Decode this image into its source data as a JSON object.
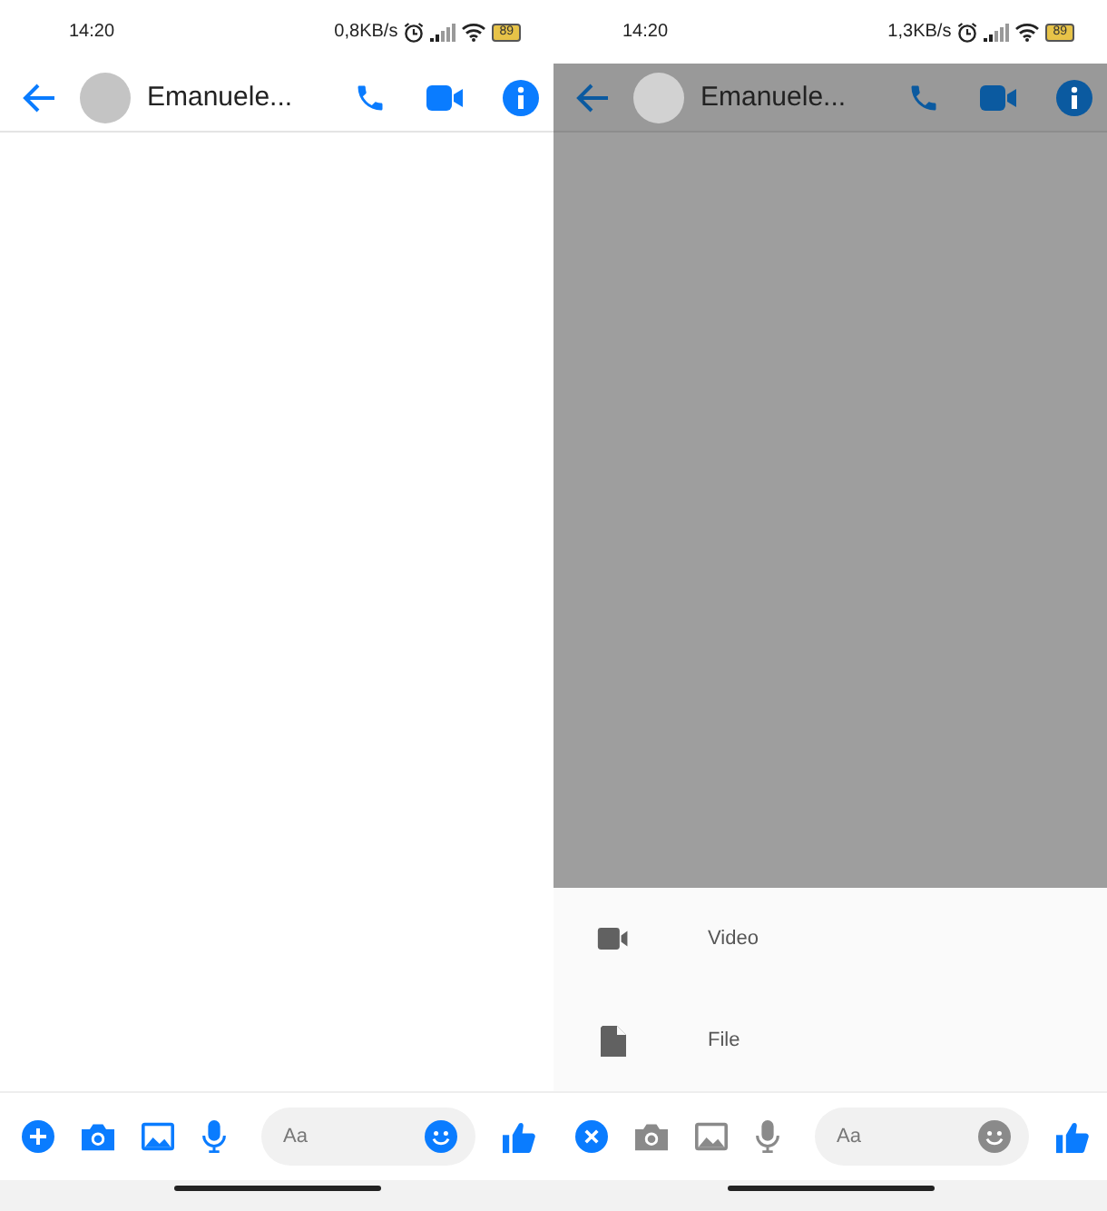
{
  "screens": [
    {
      "status_bar": {
        "time": "14:20",
        "speed": "0,8KB/s",
        "battery": "89"
      },
      "header": {
        "contact_name": "Emanuele..."
      },
      "attach_menu_open": false,
      "composer": {
        "placeholder": "Aa"
      }
    },
    {
      "status_bar": {
        "time": "14:20",
        "speed": "1,3KB/s",
        "battery": "89"
      },
      "header": {
        "contact_name": "Emanuele..."
      },
      "attach_menu_open": true,
      "menu_items": [
        {
          "kind": "video",
          "label": "Video"
        },
        {
          "kind": "file",
          "label": "File"
        }
      ],
      "composer": {
        "placeholder": "Aa"
      }
    }
  ]
}
